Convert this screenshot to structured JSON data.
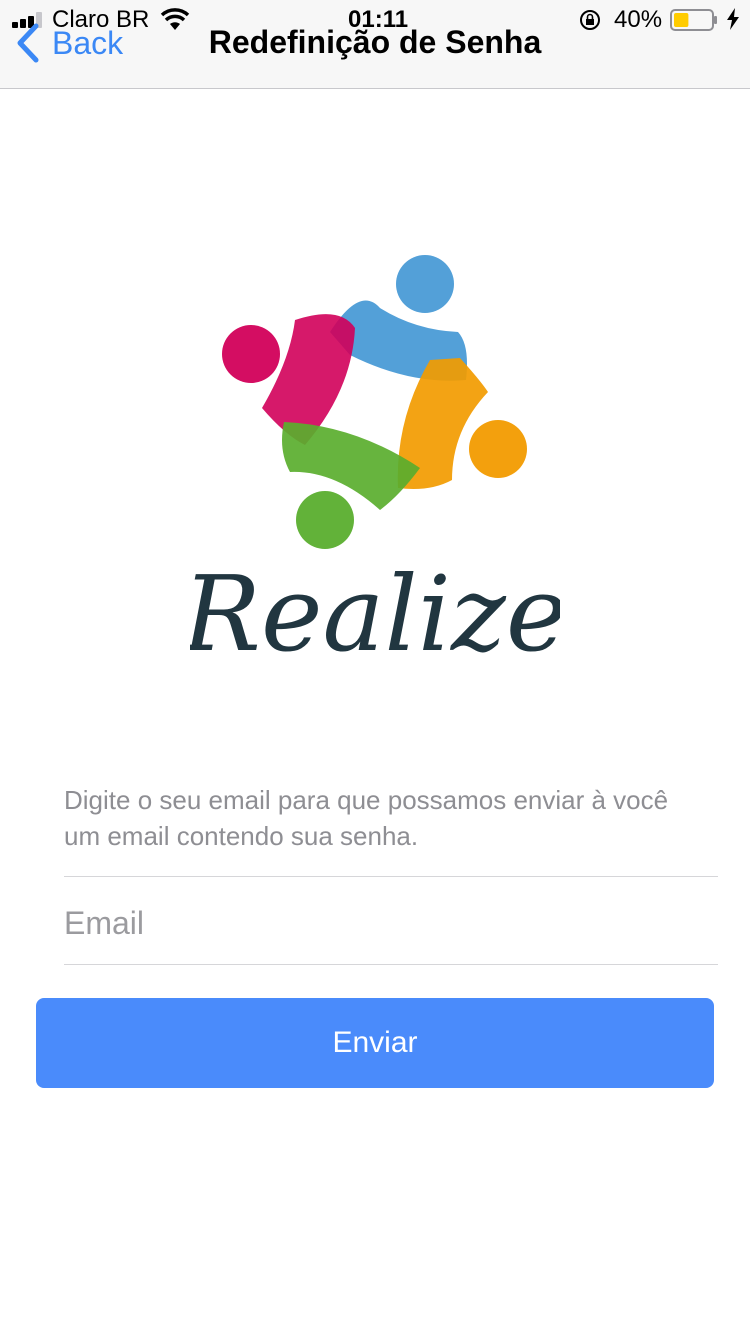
{
  "status_bar": {
    "carrier": "Claro BR",
    "time": "01:11",
    "battery_percent": "40%",
    "battery_level": 0.4
  },
  "nav": {
    "back_label": "Back",
    "title": "Redefinição de Senha"
  },
  "logo": {
    "wordmark": "Realize",
    "colors": {
      "pink": "#d2005a",
      "blue": "#4a9bd6",
      "orange": "#f29b00",
      "green": "#5aae2e",
      "text": "#213640"
    }
  },
  "form": {
    "instructions": "Digite o seu email para que possamos enviar à você um email contendo sua senha.",
    "email_placeholder": "Email",
    "email_value": "",
    "submit_label": "Enviar"
  },
  "colors": {
    "accent": "#4a8bfb",
    "link": "#3b88f5",
    "navbar_bg": "#f7f7f7"
  }
}
